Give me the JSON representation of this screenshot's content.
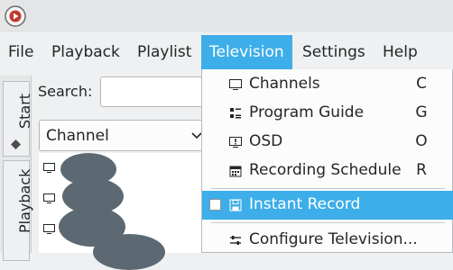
{
  "app": {
    "logo": "player-logo-icon"
  },
  "menubar": {
    "items": [
      "File",
      "Playback",
      "Playlist",
      "Television",
      "Settings",
      "Help"
    ],
    "active": "Television"
  },
  "sidebar": {
    "tabs": [
      "Start",
      "Playback"
    ]
  },
  "search": {
    "label": "Search:",
    "value": ""
  },
  "channel_filter": {
    "selected": "Channel",
    "icon": "chevron-down-icon"
  },
  "channel_list": {
    "row_icon": "tv-icon",
    "rows": 3
  },
  "television_menu": {
    "items": [
      {
        "label": "Channels",
        "shortcut": "C",
        "icon": "monitor-icon"
      },
      {
        "label": "Program Guide",
        "shortcut": "G",
        "icon": "program-guide-icon"
      },
      {
        "label": "OSD",
        "shortcut": "O",
        "icon": "osd-icon"
      },
      {
        "label": "Recording Schedule",
        "shortcut": "R",
        "icon": "calendar-icon"
      },
      {
        "label": "Instant Record",
        "shortcut": "",
        "icon": "save-icon",
        "checkable": true,
        "checked": false,
        "highlighted": true
      },
      {
        "label": "Configure Television...",
        "shortcut": "",
        "icon": "configure-icon"
      }
    ]
  },
  "colors": {
    "accent": "#3daee9",
    "window": "#eff0f1",
    "redaction": "#5c6972"
  }
}
